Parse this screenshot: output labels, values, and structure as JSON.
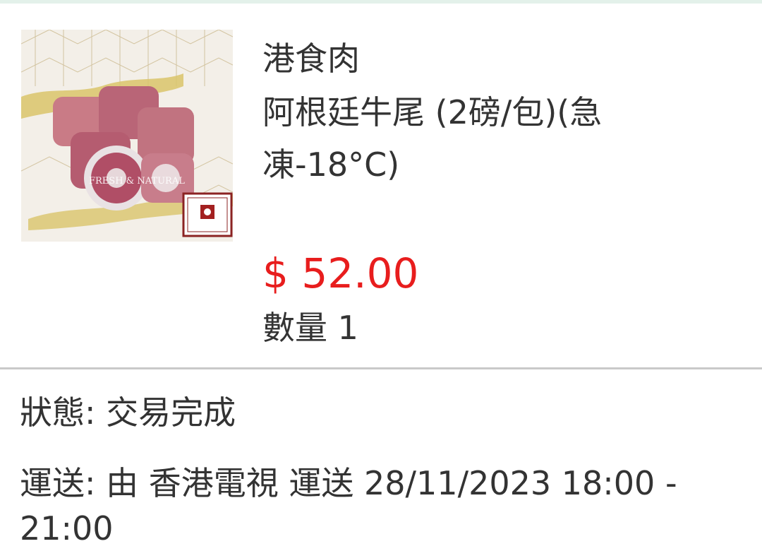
{
  "order": {
    "store_name": "港食肉",
    "product_name": "阿根廷牛尾 (2磅/包)(急凍-18°C)",
    "price": "$ 52.00",
    "quantity_label": "數量",
    "quantity_value": "1",
    "image_overlay_text": "FRESH & NATURAL"
  },
  "status": {
    "label": "狀態:",
    "value": "交易完成"
  },
  "delivery": {
    "label": "運送:",
    "by": "由",
    "carrier": "香港電視",
    "action": "運送",
    "window": "28/11/2023 18:00 - 21:00"
  },
  "colors": {
    "price": "#e81d1d",
    "text": "#333333",
    "divider": "#c9c9c9",
    "top_strip": "#e3f1ea"
  }
}
